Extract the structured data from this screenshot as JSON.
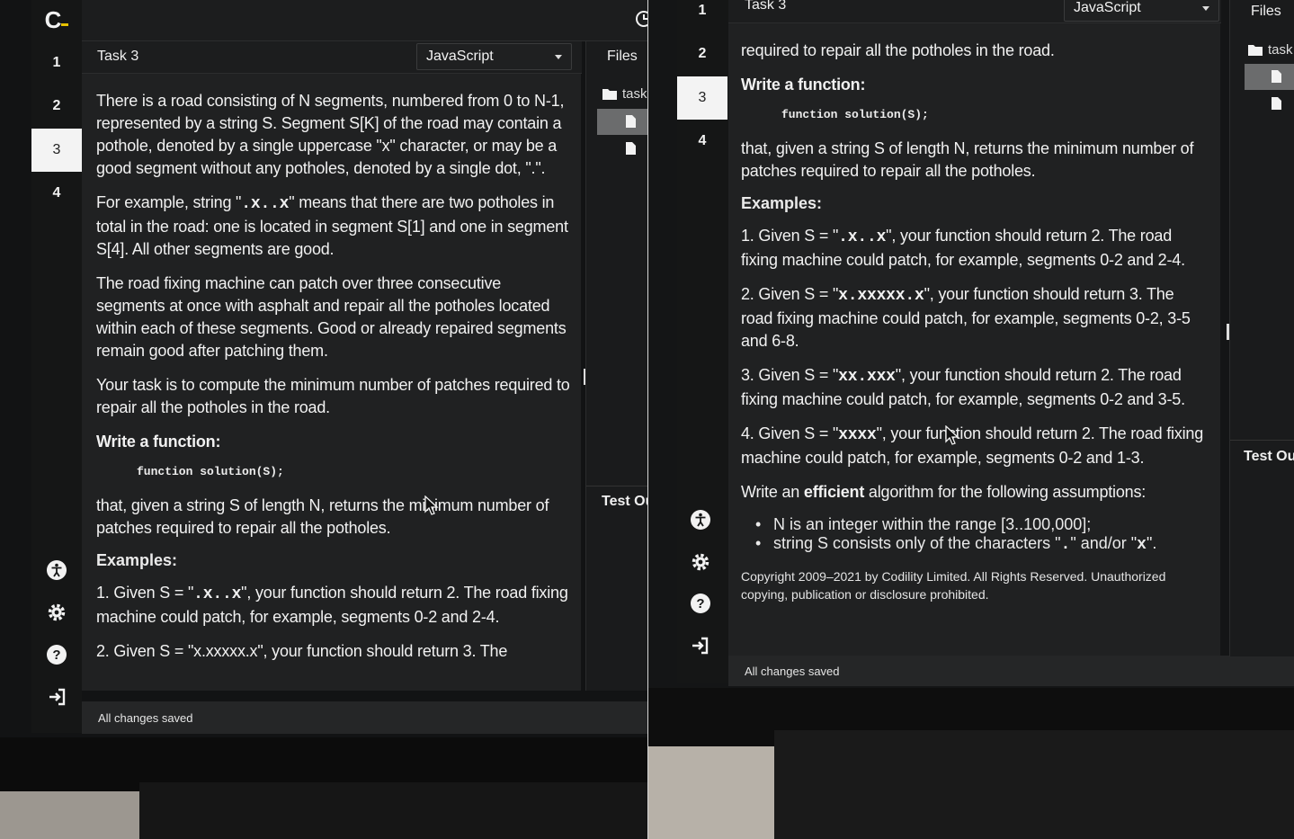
{
  "app": {
    "logo": "C",
    "task_title": "Task 3",
    "language": "JavaScript",
    "files_label": "Files",
    "folder_label": "task",
    "test_tab_label": "Test Ou",
    "status": "All changes saved"
  },
  "nav": {
    "items": [
      "1",
      "2",
      "3",
      "4"
    ],
    "active": "3"
  },
  "icons": [
    "logo-icon",
    "timer-icon",
    "accessibility-icon",
    "gear-icon",
    "help-icon",
    "exit-icon",
    "folder-icon",
    "file-icon",
    "cursor-icon"
  ],
  "problem": {
    "p1": "There is a road consisting of N segments, numbered from 0 to N-1, represented by a string S. Segment S[K] of the road may contain a pothole, denoted by a single uppercase \"x\" character, or may be a good segment without any potholes, denoted by a single dot, \".\".",
    "p2_prefix": "For example, string \"",
    "p2_code": ".x..x",
    "p2_suffix": "\" means that there are two potholes in total in the road: one is located in segment S[1] and one in segment S[4]. All other segments are good.",
    "p3": "The road fixing machine can patch over three consecutive segments at once with asphalt and repair all the potholes located within each of these segments. Good or already repaired segments remain good after patching them.",
    "p4": "Your task is to compute the minimum number of patches required to repair all the potholes in the road.",
    "p4_tail": "required to repair all the potholes in the road.",
    "write_fn": "Write a function:",
    "fn_sig": "function solution(S);",
    "p5": "that, given a string S of length N, returns the minimum number of patches required to repair all the potholes.",
    "examples_heading": "Examples:",
    "ex1_a": "1. Given S = \"",
    "ex1_code": ".x..x",
    "ex1_b": "\", your function should return 2. The road fixing machine could patch, for example, segments 0-2 and 2-4.",
    "ex2_a": "2. Given S = \"",
    "ex2_code": "x.xxxxx.x",
    "ex2_b": "\", your function should return 3. The road fixing machine could patch, for example, segments 0-2, 3-5 and 6-8.",
    "ex2_cut": "2. Given S = \"x.xxxxx.x\", your function should return 3. The",
    "ex3_a": "3. Given S = \"",
    "ex3_code": "xx.xxx",
    "ex3_b": "\", your function should return 2. The road fixing machine could patch, for example, segments 0-2 and 3-5.",
    "ex4_a": "4. Given S = \"",
    "ex4_code": "xxxx",
    "ex4_b": "\", your function should return 2. The road fixing machine could patch, for example, segments 0-2 and 1-3.",
    "assump_a": "Write an ",
    "assump_bold": "efficient",
    "assump_b": " algorithm for the following assumptions:",
    "bullet1": "N is an integer within the range [3..100,000];",
    "bullet2_a": "string S consists only of the characters \"",
    "bullet2_code1": ".",
    "bullet2_b": "\" and/or \"",
    "bullet2_code2": "x",
    "bullet2_c": "\".",
    "copyright": "Copyright 2009–2021 by Codility Limited. All Rights Reserved. Unauthorized copying, publication or disclosure prohibited."
  }
}
